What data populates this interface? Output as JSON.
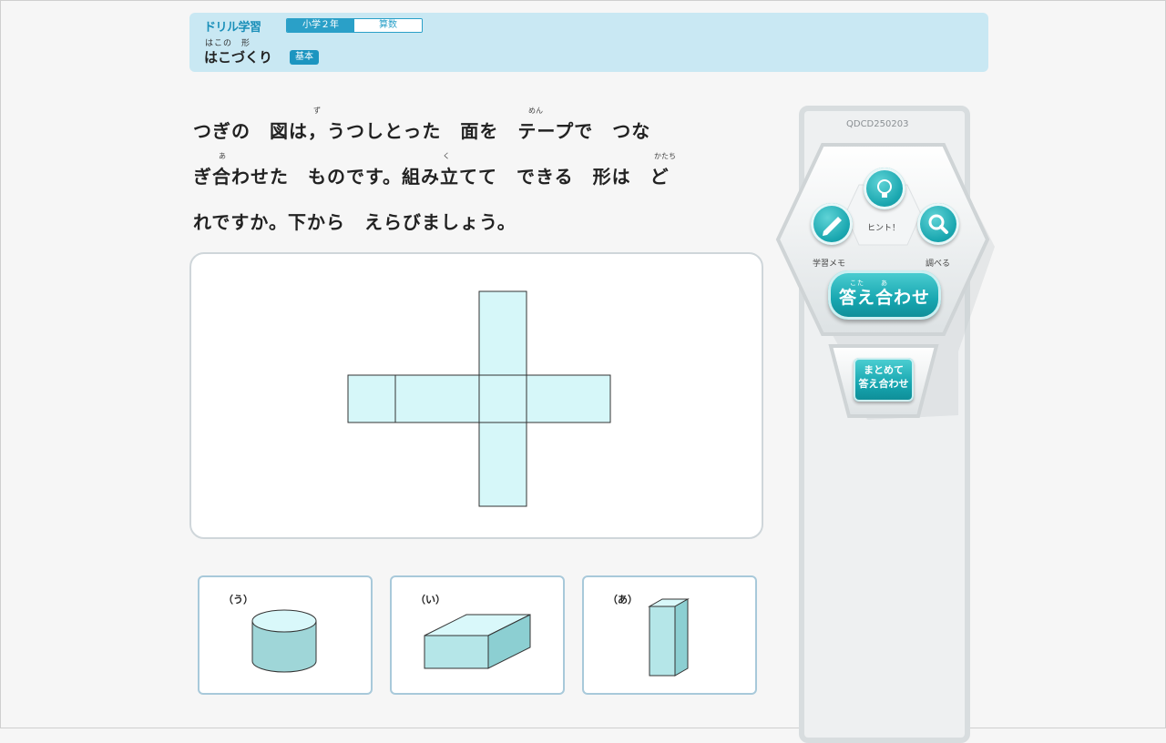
{
  "header": {
    "title": "ドリル学習",
    "grade": "小学２年",
    "subject": "算数",
    "unit_ruby": "はこの　形",
    "unit": "はこづくり",
    "level": "基本"
  },
  "question": {
    "lines": [
      "つぎの　図は，うつしとった　面を　テープで　つな",
      "ぎ合わせた　ものです。組み立てて　できる　形は　ど",
      "れですか。下から　えらびましょう。"
    ],
    "ruby": {
      "zu": "ず",
      "men": "めん",
      "a": "あ",
      "ku": "く",
      "katachi": "かたち"
    }
  },
  "options": [
    {
      "label": "（う）",
      "shape": "cylinder"
    },
    {
      "label": "（い）",
      "shape": "flat-box"
    },
    {
      "label": "（あ）",
      "shape": "tall-box"
    }
  ],
  "side": {
    "code": "QDCD250203",
    "hint_label": "ヒント！",
    "memo_label": "学習メモ",
    "search_label": "調べる",
    "answer_label": "答え合わせ",
    "answer_ruby_kotae": "こた",
    "answer_ruby_a": "あ",
    "batch_line1": "まとめて",
    "batch_line2": "答え合わせ",
    "icons": {
      "hint": "lightbulb-icon",
      "memo": "pencil-icon",
      "search": "magnifier-icon"
    }
  },
  "colors": {
    "accent": "#1aa7b0",
    "header_bg": "#c9e8f3",
    "net_fill": "#d6f7f9"
  }
}
